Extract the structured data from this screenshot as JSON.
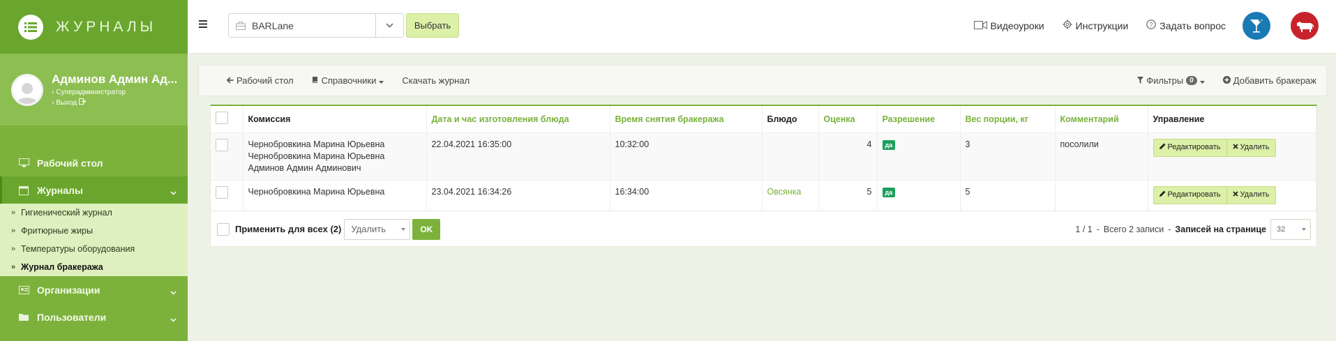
{
  "sidebar": {
    "brand_title": "ЖУРНАЛЫ",
    "profile": {
      "name": "Админов Админ Ад...",
      "role": "Суперадминистратор",
      "logout": "Выход"
    },
    "nav": [
      {
        "label": "Рабочий стол",
        "icon": "desktop-icon"
      },
      {
        "label": "Журналы",
        "icon": "calendar-icon",
        "active": true
      },
      {
        "label": "Организации",
        "icon": "org-icon"
      },
      {
        "label": "Пользователи",
        "icon": "folder-icon"
      }
    ],
    "journals": [
      {
        "label": "Гигиенический журнал"
      },
      {
        "label": "Фритюрные жиры"
      },
      {
        "label": "Температуры оборудования"
      },
      {
        "label": "Журнал бракеража",
        "current": true
      }
    ]
  },
  "topbar": {
    "org_select": "BARLane",
    "choose_label": "Выбрать",
    "links": {
      "video": "Видеоуроки",
      "instructions": "Инструкции",
      "ask": "Задать вопрос"
    },
    "colors": {
      "bar_circle": "#1a7ab4",
      "meat_circle": "#c8232c"
    }
  },
  "toolbar": {
    "desktop": "Рабочий стол",
    "references": "Справочники",
    "download": "Скачать журнал",
    "filters": "Фильтры",
    "filters_count": "0",
    "add": "Добавить бракераж"
  },
  "table": {
    "headers": {
      "commission": "Комиссия",
      "made_at": "Дата и час изготовления блюда",
      "taken_at": "Время снятия бракеража",
      "dish": "Блюдо",
      "score": "Оценка",
      "permission": "Разрешение",
      "weight": "Вес порции, кг",
      "comment": "Комментарий",
      "manage": "Управление"
    },
    "rows": [
      {
        "commission": [
          "Чернобровкина Марина Юрьевна",
          "Чернобровкина Марина Юрьевна",
          "Админов Админ Админович"
        ],
        "made_at": "22.04.2021 16:35:00",
        "taken_at": "10:32:00",
        "dish": "",
        "score": "4",
        "permission": "да",
        "weight": "3",
        "comment": "посолили"
      },
      {
        "commission": [
          "Чернобровкина Марина Юрьевна"
        ],
        "made_at": "23.04.2021 16:34:26",
        "taken_at": "16:34:00",
        "dish": "Овсянка",
        "score": "5",
        "permission": "да",
        "weight": "5",
        "comment": ""
      }
    ],
    "edit_label": "Редактировать",
    "delete_label": "Удалить"
  },
  "footer": {
    "apply_all": "Применить для всех (2)",
    "action": "Удалить",
    "ok": "OK",
    "pages": "1 / 1",
    "sep": "-",
    "total": "Всего 2 записи",
    "per_page_label": "Записей на странице",
    "per_page": "32"
  }
}
